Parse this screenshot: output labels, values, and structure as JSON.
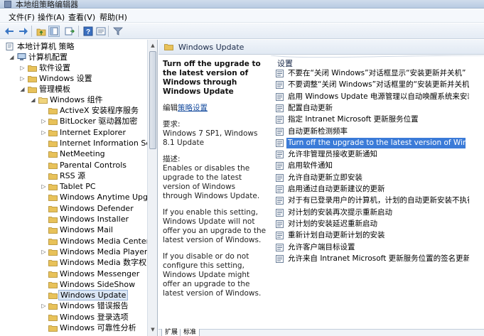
{
  "window": {
    "title": "本地组策略编辑器"
  },
  "menu": [
    {
      "label": "文件(F)"
    },
    {
      "label": "操作(A)"
    },
    {
      "label": "查看(V)"
    },
    {
      "label": "帮助(H)"
    }
  ],
  "toolbar": {
    "buttons": [
      "back-arrow-icon",
      "forward-arrow-icon",
      "up-folder-icon",
      "show-tree-icon",
      "export-list-icon",
      "help-icon",
      "properties-icon",
      "filter-icon"
    ]
  },
  "tree": {
    "root": "本地计算机 策略",
    "computer_config": "计算机配置",
    "software_settings": "软件设置",
    "windows_settings": "Windows 设置",
    "admin_templates": "管理模板",
    "windows_components": "Windows 组件",
    "items": [
      {
        "label": "ActiveX 安装程序服务",
        "expandable": false
      },
      {
        "label": "BitLocker 驱动器加密",
        "expandable": true
      },
      {
        "label": "Internet Explorer",
        "expandable": true
      },
      {
        "label": "Internet Information Services",
        "expandable": false
      },
      {
        "label": "NetMeeting",
        "expandable": false
      },
      {
        "label": "Parental Controls",
        "expandable": false
      },
      {
        "label": "RSS 源",
        "expandable": false
      },
      {
        "label": "Tablet PC",
        "expandable": true
      },
      {
        "label": "Windows Anytime Upgrade",
        "expandable": false
      },
      {
        "label": "Windows Defender",
        "expandable": false
      },
      {
        "label": "Windows Installer",
        "expandable": false
      },
      {
        "label": "Windows Mail",
        "expandable": false
      },
      {
        "label": "Windows Media Center",
        "expandable": false
      },
      {
        "label": "Windows Media Player",
        "expandable": true
      },
      {
        "label": "Windows Media 数字权限管理",
        "expandable": false
      },
      {
        "label": "Windows Messenger",
        "expandable": false
      },
      {
        "label": "Windows SideShow",
        "expandable": false
      },
      {
        "label": "Windows Update",
        "expandable": false,
        "selected": true
      },
      {
        "label": "Windows 错误报告",
        "expandable": true
      },
      {
        "label": "Windows 登录选项",
        "expandable": false
      },
      {
        "label": "Windows 可靠性分析",
        "expandable": false
      }
    ]
  },
  "right": {
    "header": "Windows Update",
    "column_header": "设置"
  },
  "description": {
    "title": "Turn off the upgrade to the latest version of Windows through Windows Update",
    "edit_prefix": "编辑",
    "edit_link": "策略设置",
    "requirements_label": "要求:",
    "requirements": "Windows 7 SP1, Windows 8.1 Update",
    "description_label": "描述:",
    "para1": "Enables or disables the upgrade to the latest version of Windows through Windows Update.",
    "para2": "If you enable this setting, Windows Update will not offer you an upgrade to the latest version of Windows.",
    "para3": "If you disable or do not configure this setting, Windows Update might offer an upgrade to the latest version of Windows."
  },
  "settings": [
    {
      "label": "不要在“关闭 Windows”对话框显示“安装更新并关机”"
    },
    {
      "label": "不要调整“关闭 Windows”对话框里的“安装更新并关机..."
    },
    {
      "label": "启用 Windows Update 电源管理以自动唤醒系统来安装计..."
    },
    {
      "label": "配置自动更新"
    },
    {
      "label": "指定 Intranet Microsoft 更新服务位置"
    },
    {
      "label": "自动更新检测频率"
    },
    {
      "label": "Turn off the upgrade to the latest version of Windows...",
      "selected": true
    },
    {
      "label": "允许非管理员接收更新通知"
    },
    {
      "label": "启用软件通知"
    },
    {
      "label": "允许自动更新立即安装"
    },
    {
      "label": "启用通过自动更新建议的更新"
    },
    {
      "label": "对于有已登录用户的计算机，计划的自动更新安装不执行重..."
    },
    {
      "label": "对计划的安装再次提示重新启动"
    },
    {
      "label": "对计划的安装延迟重新启动"
    },
    {
      "label": "重新计划自动更新计划的安装"
    },
    {
      "label": "允许客户端目标设置"
    },
    {
      "label": "允许来自 Intranet Microsoft 更新服务位置的签名更新"
    }
  ],
  "bottom_tabs": [
    {
      "label": "扩展"
    },
    {
      "label": "标准"
    }
  ],
  "colors": {
    "selection": "#3b7bd8",
    "folder": "#e8c25a",
    "link": "#1a4fa0"
  }
}
